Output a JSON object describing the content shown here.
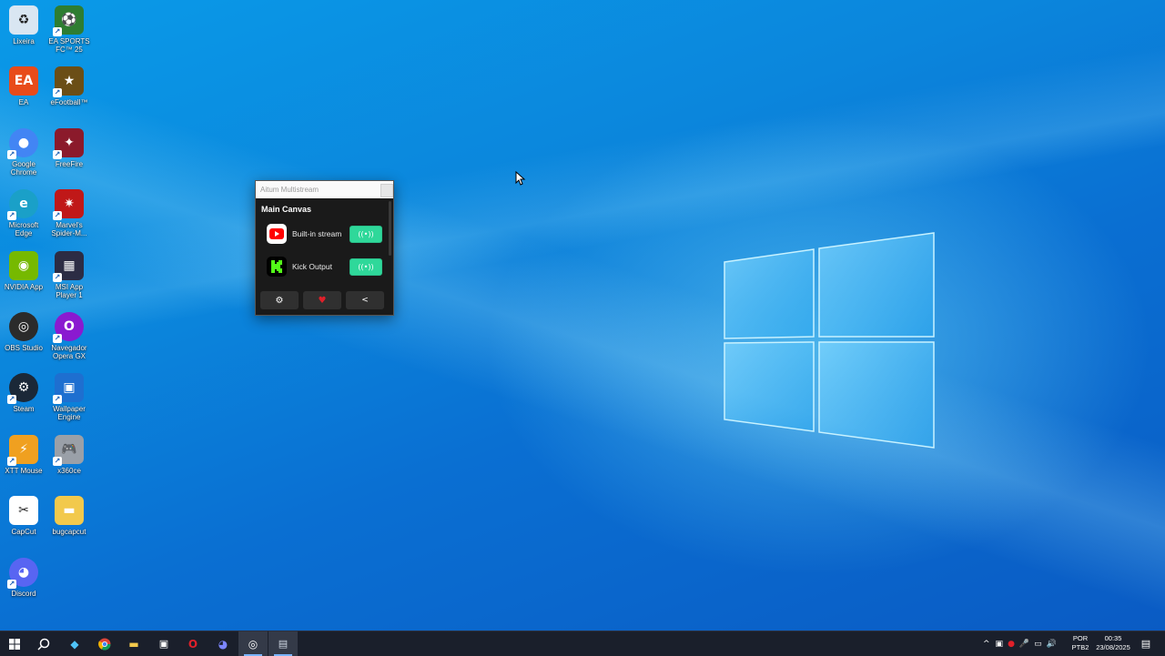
{
  "desktop_icons": [
    {
      "label": "Lixeira",
      "icon": "recycle-bin-icon",
      "color": "#d9e6f2",
      "glyph": "♻"
    },
    {
      "label": "EA SPORTS FC™ 25",
      "icon": "ea-fc25-icon",
      "color": "#2e7d32",
      "glyph": "⚽"
    },
    {
      "label": "EA",
      "icon": "ea-app-icon",
      "color": "#e84b1a",
      "glyph": "EA"
    },
    {
      "label": "eFootball™",
      "icon": "efootball-icon",
      "color": "#6b4e16",
      "glyph": "★"
    },
    {
      "label": "Google Chrome",
      "icon": "chrome-icon",
      "color": "#4285f4",
      "glyph": "●"
    },
    {
      "label": "FreeFire",
      "icon": "freefire-icon",
      "color": "#8b1a2b",
      "glyph": "✦"
    },
    {
      "label": "Microsoft Edge",
      "icon": "edge-icon",
      "color": "#1aa0c8",
      "glyph": "e"
    },
    {
      "label": "Marvel's Spider-M...",
      "icon": "spiderman-icon",
      "color": "#c01818",
      "glyph": "✷"
    },
    {
      "label": "NVIDIA App",
      "icon": "nvidia-icon",
      "color": "#76b900",
      "glyph": "◉"
    },
    {
      "label": "MSI App Player 1",
      "icon": "msi-app-player-icon",
      "color": "#2c2c44",
      "glyph": "▦"
    },
    {
      "label": "OBS Studio",
      "icon": "obs-icon",
      "color": "#2b2b2b",
      "glyph": "◎"
    },
    {
      "label": "Navegador Opera GX",
      "icon": "opera-gx-icon",
      "color": "#8a1ad0",
      "glyph": "O"
    },
    {
      "label": "Steam",
      "icon": "steam-icon",
      "color": "#1b2838",
      "glyph": "⚙"
    },
    {
      "label": "Wallpaper Engine",
      "icon": "wallpaper-engine-icon",
      "color": "#1e6fd0",
      "glyph": "▣"
    },
    {
      "label": "XTT Mouse",
      "icon": "xtt-mouse-icon",
      "color": "#f0a020",
      "glyph": "⚡"
    },
    {
      "label": "x360ce",
      "icon": "gamepad-icon",
      "color": "#9aa0a8",
      "glyph": "🎮"
    },
    {
      "label": "CapCut",
      "icon": "capcut-icon",
      "color": "#ffffff",
      "glyph": "✂"
    },
    {
      "label": "bugcapcut",
      "icon": "folder-icon",
      "color": "#f2c94c",
      "glyph": "▬"
    },
    {
      "label": "Discord",
      "icon": "discord-icon",
      "color": "#5865f2",
      "glyph": "◕"
    }
  ],
  "app_window": {
    "title": "Aitum Multistream",
    "canvas_title": "Main Canvas",
    "outputs": [
      {
        "name": "Built-in stream",
        "platform_icon": "youtube-icon",
        "platform_color": "#ff0000",
        "status": "active"
      },
      {
        "name": "Kick Output",
        "platform_icon": "kick-icon",
        "platform_color": "#53fc18",
        "status": "active"
      }
    ],
    "toggle_color": "#2fd89a",
    "toolbar": [
      {
        "icon": "gear-icon",
        "glyph": "⚙"
      },
      {
        "icon": "heart-icon",
        "glyph": "♥"
      },
      {
        "icon": "share-icon",
        "glyph": "⇪"
      }
    ]
  },
  "taskbar": {
    "apps": [
      {
        "icon": "windows-start-icon"
      },
      {
        "icon": "search-icon"
      },
      {
        "icon": "copilot-icon"
      },
      {
        "icon": "chrome-icon"
      },
      {
        "icon": "file-explorer-icon"
      },
      {
        "icon": "microsoft-store-icon"
      },
      {
        "icon": "opera-icon"
      },
      {
        "icon": "discord-icon"
      },
      {
        "icon": "obs-icon"
      },
      {
        "icon": "aitum-multistream-icon"
      }
    ],
    "tray": {
      "language": "POR",
      "layout": "PTB2",
      "time": "00:35",
      "date": "23/08/2025"
    }
  }
}
